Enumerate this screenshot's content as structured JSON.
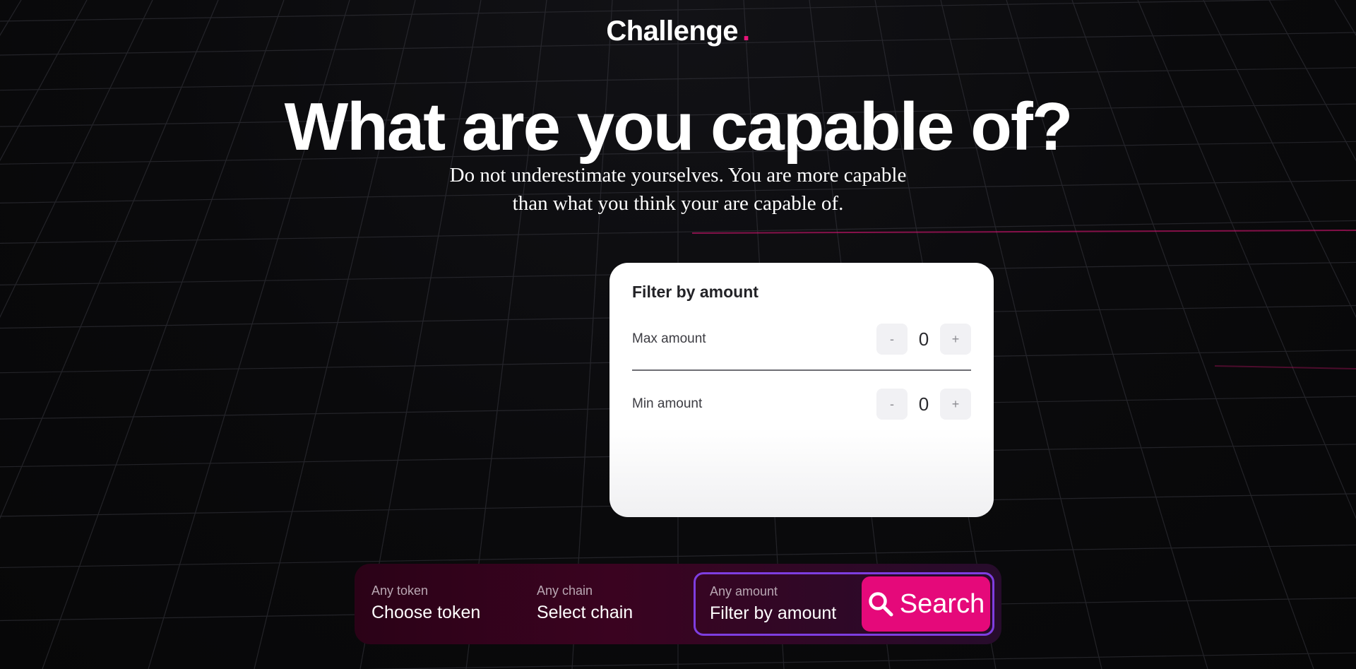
{
  "brand": {
    "name": "Challenge",
    "dot": ".",
    "accent_color": "#e8157a"
  },
  "hero": {
    "title": "What are you capable of?",
    "subtitle_line1": "Do not underestimate yourselves. You are more capable",
    "subtitle_line2": "than what you think your are capable of."
  },
  "filter_card": {
    "title": "Filter by amount",
    "max": {
      "label": "Max amount",
      "minus": "-",
      "value": "0",
      "plus": "+"
    },
    "min": {
      "label": "Min amount",
      "minus": "-",
      "value": "0",
      "plus": "+"
    }
  },
  "search_bar": {
    "token": {
      "label": "Any token",
      "value": "Choose token"
    },
    "chain": {
      "label": "Any chain",
      "value": "Select chain"
    },
    "amount": {
      "label": "Any amount",
      "value": "Filter by amount"
    },
    "search_button": {
      "label": "Search",
      "icon": "search-icon",
      "color": "#e5097a"
    },
    "active_border_color": "#7e3ee0"
  }
}
